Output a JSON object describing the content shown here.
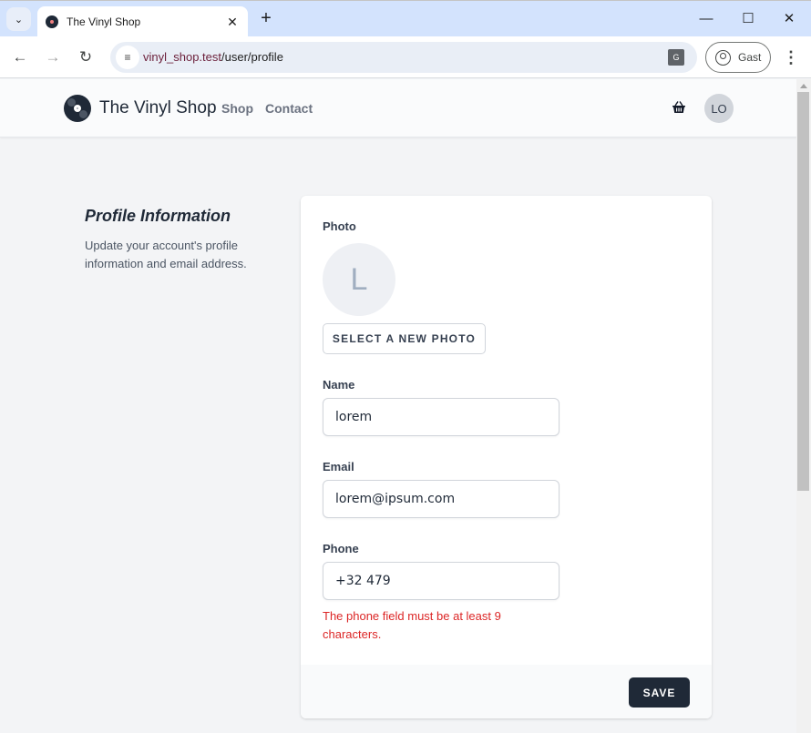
{
  "browser": {
    "tab_title": "The Vinyl Shop",
    "url_host": "vinyl_shop.test",
    "url_path": "/user/profile",
    "profile_label": "Gast",
    "icons": {
      "tab_search": "chevron-down-icon",
      "tab_close": "close-icon",
      "new_tab": "plus-icon",
      "back": "arrow-left-icon",
      "forward": "arrow-right-icon",
      "reload": "reload-icon",
      "site_info": "tune-icon",
      "translate": "translate-icon",
      "profile": "account-circle-icon",
      "menu": "more-vert-icon"
    }
  },
  "navbar": {
    "brand": "The Vinyl Shop",
    "links": [
      {
        "label": "Shop"
      },
      {
        "label": "Contact"
      }
    ],
    "basket_icon": "basket-icon",
    "avatar_initials": "LO"
  },
  "section": {
    "title": "Profile Information",
    "description": "Update your account's profile information and email address."
  },
  "form": {
    "photo_label": "Photo",
    "photo_initial": "L",
    "select_photo_label": "SELECT A NEW PHOTO",
    "name_label": "Name",
    "name_value": "lorem",
    "email_label": "Email",
    "email_value": "lorem@ipsum.com",
    "phone_label": "Phone",
    "phone_value": "+32 479",
    "phone_error": "The phone field must be at least 9 characters.",
    "save_label": "SAVE"
  },
  "colors": {
    "primary": "#1f2937",
    "error": "#dc2626",
    "background": "#f3f4f6",
    "chrome_tabstrip": "#d3e3fd"
  }
}
